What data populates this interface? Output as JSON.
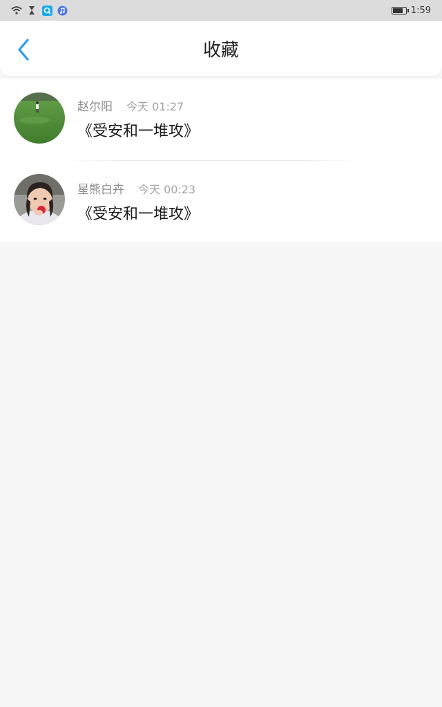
{
  "status_bar": {
    "time": "1:59",
    "battery_level": 0.85,
    "icons": [
      "wifi-icon",
      "hourglass-icon",
      "search-app-icon",
      "music-app-icon"
    ]
  },
  "header": {
    "title": "收藏",
    "back_icon": "chevron-left-icon"
  },
  "favorites": [
    {
      "author": "赵尔阳",
      "time": "今天 01:27",
      "title": "《受安和一堆攻》",
      "avatar": "photo-grass-field"
    },
    {
      "author": "星熊白卉",
      "time": "今天 00:23",
      "title": "《受安和一堆攻》",
      "avatar": "photo-person-eating"
    }
  ],
  "colors": {
    "accent": "#2b9af3",
    "page_background": "#f8f7f7",
    "status_bar": "#dcdcdc"
  }
}
